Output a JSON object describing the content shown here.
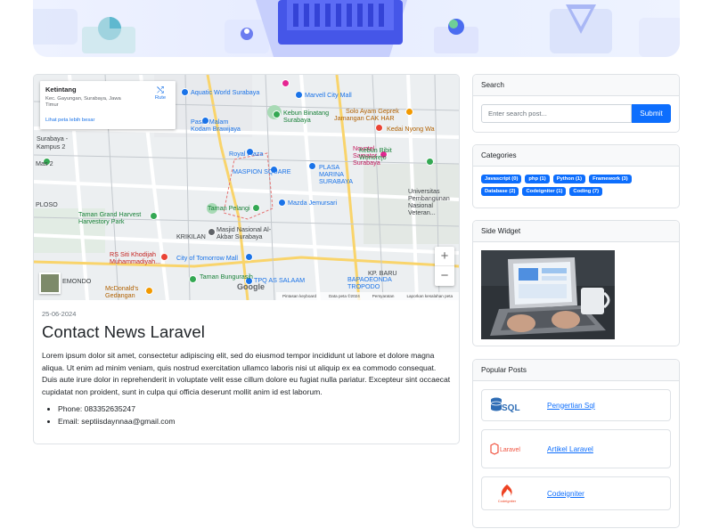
{
  "map": {
    "info_title": "Ketintang",
    "info_address": "Kec. Gayungan, Surabaya, Jawa Timur",
    "info_more_link": "Lihat peta lebih besar",
    "info_route": "Rute",
    "zoom_in": "+",
    "zoom_out": "−",
    "google_logo": "Google",
    "footer": [
      "Pintasan keyboard",
      "Data peta ©2024",
      "Persyaratan",
      "Laporkan kesalahan peta"
    ],
    "labels": [
      {
        "text": "Aquatic World Surabaya",
        "color": "blue"
      },
      {
        "text": "Marvell City Mall",
        "color": "blue"
      },
      {
        "text": "Pasar Malam",
        "color": "blue"
      },
      {
        "text": "Kodam Brawijaya",
        "color": "blue"
      },
      {
        "text": "Kebun Binatang",
        "color": "green"
      },
      {
        "text": "Surabaya",
        "color": "green"
      },
      {
        "text": "Solo Ayam Geprek",
        "color": "orange"
      },
      {
        "text": "Jamangan CAK HAR",
        "color": "orange"
      },
      {
        "text": "Kedai Nyong Wa",
        "color": "orange"
      },
      {
        "text": "Surabaya - Kampus 2",
        "color": "dark"
      },
      {
        "text": "Royal Plaza",
        "color": "blue"
      },
      {
        "text": "Novotel Samator Surabaya",
        "color": "pink"
      },
      {
        "text": "Kebun Bibit",
        "color": "green"
      },
      {
        "text": "Wonorejo",
        "color": "green"
      },
      {
        "text": "MASPION SQUARE",
        "color": "blue"
      },
      {
        "text": "PLASA MARINA SURABAYA",
        "color": "blue"
      },
      {
        "text": "Universitas Pembangunan Nasional Veteran...",
        "color": "dark"
      },
      {
        "text": "Taman Pelangi",
        "color": "green"
      },
      {
        "text": "Mazda Jemursari",
        "color": "blue"
      },
      {
        "text": "Taman Grand Harvest Harvestory Park",
        "color": "green"
      },
      {
        "text": "KRIKILAN",
        "color": "dark"
      },
      {
        "text": "Masjid Nasional Al-Akbar Surabaya",
        "color": "dark"
      },
      {
        "text": "RS Siti Khodijah Muhammadiyah...",
        "color": "red"
      },
      {
        "text": "City of Tomorrow Mall",
        "color": "blue"
      },
      {
        "text": "Taman Bungurasih",
        "color": "green"
      },
      {
        "text": "TPQ AS SALAAM",
        "color": "blue"
      },
      {
        "text": "KP. BARU",
        "color": "dark"
      },
      {
        "text": "BAPAOEONDA TROPODO",
        "color": "blue"
      },
      {
        "text": "EMONDO",
        "color": "dark"
      },
      {
        "text": "McDonald's Gedangan",
        "color": "orange"
      },
      {
        "text": "PLOSO",
        "color": "dark"
      },
      {
        "text": "Mas 2",
        "color": "dark"
      }
    ]
  },
  "post": {
    "date": "25-06-2024",
    "title": "Contact News Laravel",
    "body": "Lorem ipsum dolor sit amet, consectetur adipiscing elit, sed do eiusmod tempor incididunt ut labore et dolore magna aliqua. Ut enim ad minim veniam, quis nostrud exercitation ullamco laboris nisi ut aliquip ex ea commodo consequat. Duis aute irure dolor in reprehenderit in voluptate velit esse cillum dolore eu fugiat nulla pariatur. Excepteur sint occaecat cupidatat non proident, sunt in culpa qui officia deserunt mollit anim id est laborum.",
    "contacts": [
      "Phone: 083352635247",
      "Email: septiisdaynnaa@gmail.com"
    ]
  },
  "search": {
    "header": "Search",
    "placeholder": "Enter search post...",
    "button": "Submit"
  },
  "categories": {
    "header": "Categories",
    "items": [
      "Javascript (0)",
      "php (1)",
      "Python (1)",
      "Framework (3)",
      "Database (2)",
      "Codeigniter (1)",
      "Coding (7)"
    ]
  },
  "side_widget": {
    "header": "Side Widget"
  },
  "popular": {
    "header": "Popular Posts",
    "items": [
      {
        "title": "Pengertian Sql",
        "logo": "sql-logo",
        "logo_text": "SQL"
      },
      {
        "title": "Artikel Laravel",
        "logo": "laravel-logo",
        "logo_text": "Laravel"
      },
      {
        "title": "Codeigniter",
        "logo": "codeigniter-logo",
        "logo_text": "Codeigniter"
      }
    ]
  },
  "colors": {
    "primary": "#0d6efd",
    "border": "#dee2e6",
    "header_bg": "#f8f9fa"
  }
}
